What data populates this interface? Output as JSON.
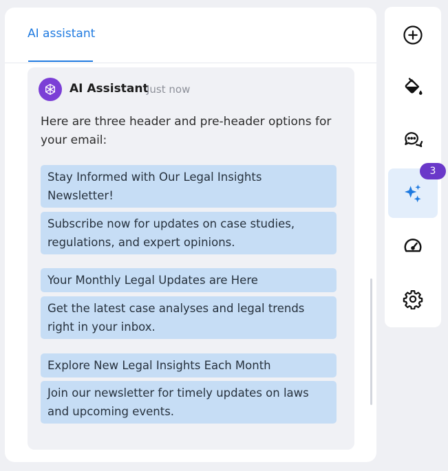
{
  "tabs": [
    {
      "label": "AI assistant",
      "active": true
    }
  ],
  "message": {
    "sender": "AI Assistant",
    "timestamp": "Just now",
    "intro": "Here are three header and pre-header options for your email:",
    "options": [
      {
        "header": "Stay Informed with Our Legal Insights Newsletter!",
        "preheader": "Subscribe now for updates on case studies, regulations, and expert opinions."
      },
      {
        "header": "Your Monthly Legal Updates are Here",
        "preheader": "Get the latest case analyses and legal trends right in your inbox."
      },
      {
        "header": "Explore New Legal Insights Each Month",
        "preheader": "Join our newsletter for timely updates on laws and upcoming events."
      }
    ]
  },
  "toolbar": {
    "items": [
      {
        "icon": "plus-circle-icon"
      },
      {
        "icon": "paint-bucket-icon"
      },
      {
        "icon": "chat-bubbles-icon"
      },
      {
        "icon": "sparkles-icon",
        "active": true,
        "badge": "3"
      },
      {
        "icon": "gauge-icon"
      },
      {
        "icon": "gear-icon"
      }
    ]
  },
  "colors": {
    "accent": "#1f7ae0",
    "option_bg": "#c6ddf5",
    "badge": "#6a38c9",
    "avatar": "#7b3fd6",
    "active_tool_bg": "#e3eefb"
  }
}
